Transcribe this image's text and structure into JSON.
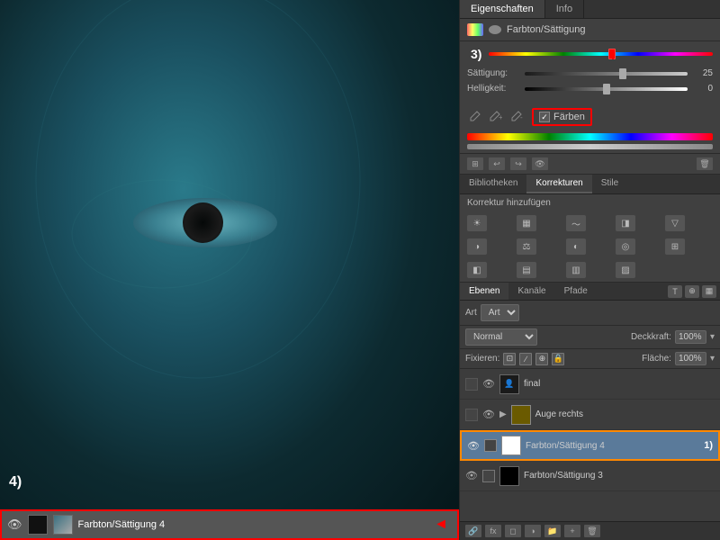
{
  "tabs": {
    "eigenschaften": "Eigenschaften",
    "info": "Info"
  },
  "properties": {
    "title": "Farbton/Sättigung",
    "annotation3": "3)",
    "saettigung_label": "Sättigung:",
    "saettigung_value": "25",
    "helligkeit_label": "Helligkeit:",
    "helligkeit_value": "0",
    "farben_label": "Färben",
    "saettigung_percent": 55
  },
  "corrections": {
    "tab1": "Bibliotheken",
    "tab2": "Korrekturen",
    "tab3": "Stile",
    "title": "Korrektur hinzufügen"
  },
  "layers": {
    "tab1": "Ebenen",
    "tab2": "Kanäle",
    "tab3": "Pfade",
    "art_label": "Art",
    "blend_label": "Normal",
    "deckkraft_label": "Deckkraft:",
    "deckkraft_value": "100%",
    "fixieren_label": "Fixieren:",
    "flaeche_label": "Fläche:",
    "flaeche_value": "100%",
    "items": [
      {
        "name": "final",
        "type": "person",
        "visible": true,
        "active": false,
        "annotation": ""
      },
      {
        "name": "Auge rechts",
        "type": "folder",
        "visible": true,
        "active": false,
        "annotation": "",
        "isFolder": true
      },
      {
        "name": "Farbton/Sättigung 4",
        "type": "hue",
        "visible": true,
        "active": true,
        "annotation": "1)"
      },
      {
        "name": "Farbton/Sättigung 3",
        "type": "hue",
        "visible": true,
        "active": false,
        "annotation": ""
      }
    ]
  },
  "canvas": {
    "annotation4": "4)",
    "layer_bar_name": "Farbton/Sättigung 4"
  },
  "icons": {
    "eye": "👁",
    "link": "🔗",
    "check": "✓",
    "arrow_right": "◄",
    "folder": "▶"
  }
}
